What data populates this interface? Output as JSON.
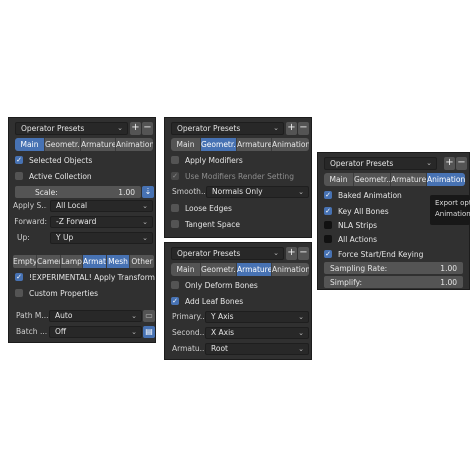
{
  "colors": {
    "panel_bg": "#303030",
    "accent": "#4772b3",
    "field_bg": "#282828",
    "button_bg": "#545454"
  },
  "panel1": {
    "presets": "Operator Presets",
    "tabs": [
      "Main",
      "Geometr...",
      "Armatures",
      "Animation"
    ],
    "active_tab": "Main",
    "selected_objects": "Selected Objects",
    "active_collection": "Active Collection",
    "scale_label": "Scale:",
    "scale_value": "1.00",
    "apply_scale_label": "Apply S...",
    "apply_scale_value": "All Local",
    "forward_label": "Forward:",
    "forward_value": "-Z Forward",
    "up_label": "Up:",
    "up_value": "Y Up",
    "object_types": [
      "Empty",
      "Camer",
      "Lamp",
      "Armat",
      "Mesh",
      "Other"
    ],
    "object_types_selected": [
      "Armat",
      "Mesh"
    ],
    "apply_transform": "!EXPERIMENTAL! Apply Transform",
    "custom_properties": "Custom Properties",
    "path_mode_label": "Path M...",
    "path_mode_value": "Auto",
    "batch_label": "Batch ...",
    "batch_value": "Off"
  },
  "panel2": {
    "presets": "Operator Presets",
    "tabs": [
      "Main",
      "Geometr...",
      "Armatures",
      "Animation"
    ],
    "active_tab": "Geometr...",
    "apply_modifiers": "Apply Modifiers",
    "use_modifiers_render": "Use Modifiers Render Setting",
    "smoothing_label": "Smooth...",
    "smoothing_value": "Normals Only",
    "loose_edges": "Loose Edges",
    "tangent_space": "Tangent Space"
  },
  "panel3": {
    "presets": "Operator Presets",
    "tabs": [
      "Main",
      "Geometr...",
      "Armatures",
      "Animation"
    ],
    "active_tab": "Armatures",
    "only_deform": "Only Deform Bones",
    "add_leaf": "Add Leaf Bones",
    "primary_label": "Primary...",
    "primary_value": "Y Axis",
    "secondary_label": "Second...",
    "secondary_value": "X Axis",
    "armature_label": "Armatu...",
    "armature_value": "Root"
  },
  "panel4": {
    "presets": "Operator Presets",
    "tabs": [
      "Main",
      "Geometr...",
      "Armatures",
      "Animation"
    ],
    "active_tab": "Animation",
    "baked_animation": "Baked Animation",
    "key_all_bones": "Key All Bones",
    "nla_strips": "NLA Strips",
    "all_actions": "All Actions",
    "force_keying": "Force Start/End Keying",
    "sampling_label": "Sampling Rate:",
    "sampling_value": "1.00",
    "simplify_label": "Simplify:",
    "simplify_value": "1.00",
    "tooltip_line1": "Export opt",
    "tooltip_line2": "Animation"
  }
}
